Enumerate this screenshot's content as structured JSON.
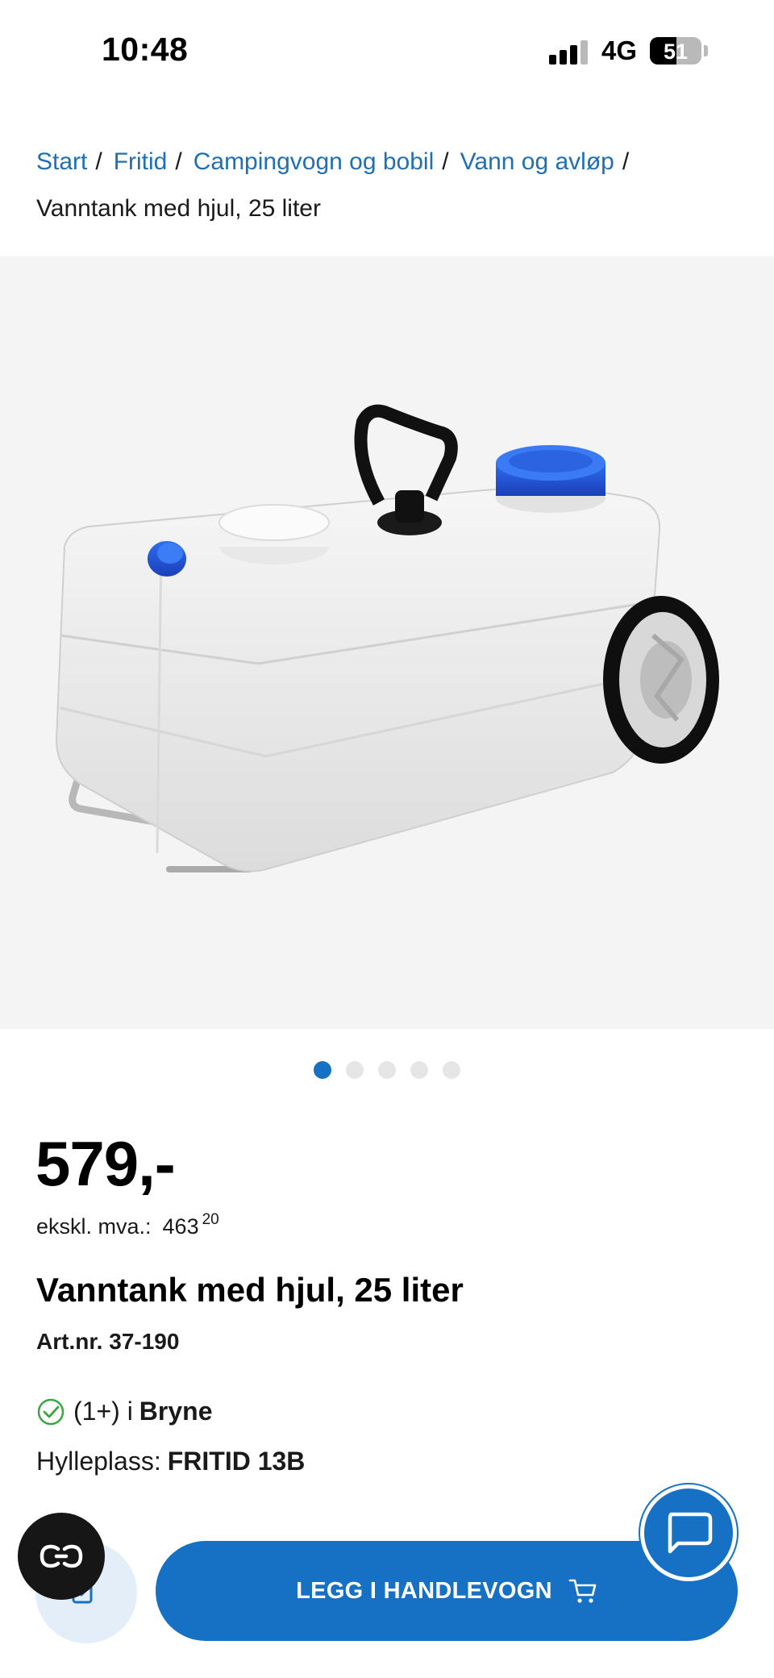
{
  "status_bar": {
    "time": "10:48",
    "network": "4G",
    "battery_percent": "51",
    "battery_level": 0.51,
    "signal_bars": 3
  },
  "breadcrumb": {
    "items": [
      "Start",
      "Fritid",
      "Campingvogn og bobil",
      "Vann og avløp"
    ],
    "separator": "/",
    "current": "Vanntank med hjul, 25 liter"
  },
  "gallery": {
    "image_alt": "product-photo",
    "dots_total": 5,
    "active_dot": 1
  },
  "product": {
    "price": "579,-",
    "ex_vat_label": "ekskl. mva.:",
    "ex_vat_whole": "463",
    "ex_vat_cents": "20",
    "title": "Vanntank med hjul, 25 liter",
    "art_label": "Art.nr.",
    "art_number": "37-190",
    "stock_count": "(1+) i",
    "stock_store": "Bryne",
    "shelf_label": "Hylleplass:",
    "shelf_value": "FRITID 13B"
  },
  "actions": {
    "add_to_cart": "LEGG I HANDLEVOGN"
  },
  "icons": {
    "stock": "check-circle-icon",
    "cart": "cart-icon",
    "chat": "chat-icon",
    "edit": "edit-icon",
    "co": "co-logo-icon"
  },
  "colors": {
    "link": "#1f6fb5",
    "primary": "#1670c4",
    "stock_ok": "#3aa544"
  }
}
